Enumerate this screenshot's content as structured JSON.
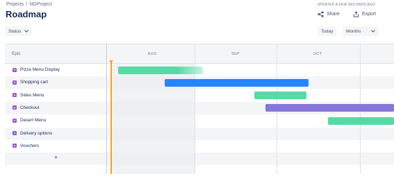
{
  "header": {
    "breadcrumb": [
      "Projects",
      "NGProject"
    ],
    "breadcrumb_sep": "/",
    "title": "Roadmap",
    "updated": "UPDATED A FEW SECONDS AGO",
    "share_label": "Share",
    "export_label": "Export"
  },
  "toolbar": {
    "status_filter": "Status",
    "today_label": "Today",
    "zoom_value": "Months"
  },
  "grid": {
    "epic_header": "Epic",
    "months": [
      "AUG",
      "SEP",
      "OCT"
    ],
    "add_label": "+"
  },
  "epics": [
    {
      "name": "Pizza Menu Display",
      "color": "#57d9a3",
      "fade": true
    },
    {
      "name": "Shopping cart",
      "color": "#2684ff",
      "fade": false
    },
    {
      "name": "Sides Menu",
      "color": "#57d9a3",
      "fade": false
    },
    {
      "name": "Checkout",
      "color": "#8777d9",
      "fade": false
    },
    {
      "name": "Desert Menu",
      "color": "#57d9a3",
      "fade": false
    },
    {
      "name": "Delivery options",
      "color": "",
      "fade": false
    },
    {
      "name": "Vouchers",
      "color": "",
      "fade": false
    }
  ],
  "colors": {
    "accent": "#0052cc",
    "today_marker": "#ff991f",
    "epic_icon": "#9b59d0"
  }
}
